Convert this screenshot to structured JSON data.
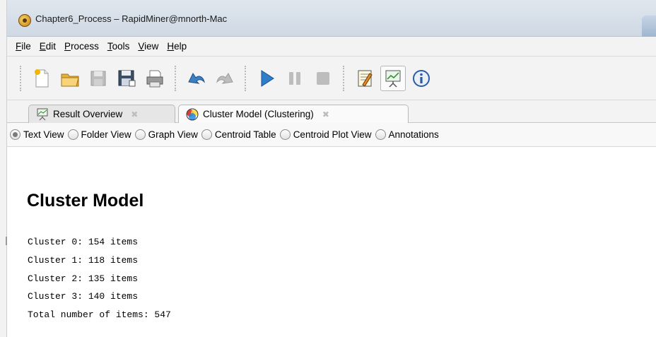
{
  "window": {
    "title": "Chapter6_Process – RapidMiner@mnorth-Mac"
  },
  "menu": {
    "items": [
      {
        "first": "F",
        "rest": "ile"
      },
      {
        "first": "E",
        "rest": "dit"
      },
      {
        "first": "P",
        "rest": "rocess"
      },
      {
        "first": "T",
        "rest": "ools"
      },
      {
        "first": "V",
        "rest": "iew"
      },
      {
        "first": "H",
        "rest": "elp"
      }
    ]
  },
  "toolbar": {
    "icons": [
      "new-process-icon",
      "open-folder-icon",
      "save-icon",
      "save-as-icon",
      "print-icon",
      "undo-icon",
      "redo-icon",
      "run-icon",
      "pause-icon",
      "stop-icon",
      "design-perspective-icon",
      "result-perspective-icon",
      "info-icon"
    ]
  },
  "tabs": [
    {
      "label": "Result Overview",
      "close": "✖"
    },
    {
      "label": "Cluster Model (Clustering)",
      "close": "✖"
    }
  ],
  "views": {
    "options": [
      "Text View",
      "Folder View",
      "Graph View",
      "Centroid Table",
      "Centroid Plot View",
      "Annotations"
    ],
    "selected": "Text View"
  },
  "result": {
    "heading": "Cluster Model",
    "lines": [
      "Cluster 0: 154 items",
      "Cluster 1: 118 items",
      "Cluster 2: 135 items",
      "Cluster 3: 140 items",
      "Total number of items: 547"
    ]
  }
}
